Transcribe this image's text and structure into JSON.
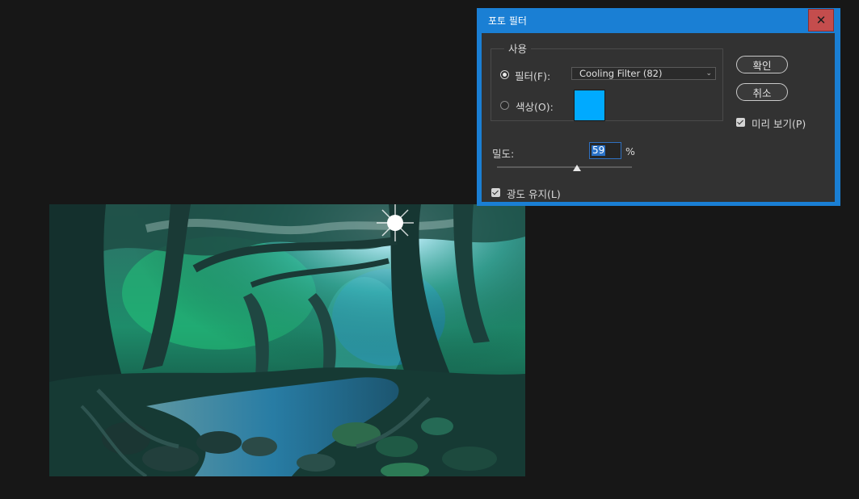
{
  "dialog": {
    "title": "포토 필터",
    "close_glyph": "✕",
    "use_group_label": "사용",
    "filter_label": "필터(F):",
    "filter_selected": "Cooling Filter (82)",
    "color_label": "색상(O):",
    "color_swatch": "#00aaff",
    "ok_label": "확인",
    "cancel_label": "취소",
    "preview_label": "미리 보기(P)",
    "density_label": "밀도:",
    "density_value": "59",
    "density_unit": "%",
    "density_fraction": 0.59,
    "preserve_luminosity_label": "광도 유지(L)"
  },
  "state": {
    "filter_radio_selected": true,
    "color_radio_selected": false,
    "preview_checked": true,
    "preserve_luminosity_checked": true
  },
  "colors": {
    "app_background": "#171717",
    "dialog_frame": "#1a7fd4",
    "dialog_body": "#323232",
    "close_button": "#c44d4d"
  },
  "icons": {
    "close": "close-icon",
    "dropdown": "chevron-down-icon",
    "checkbox": "checkmark-icon"
  }
}
